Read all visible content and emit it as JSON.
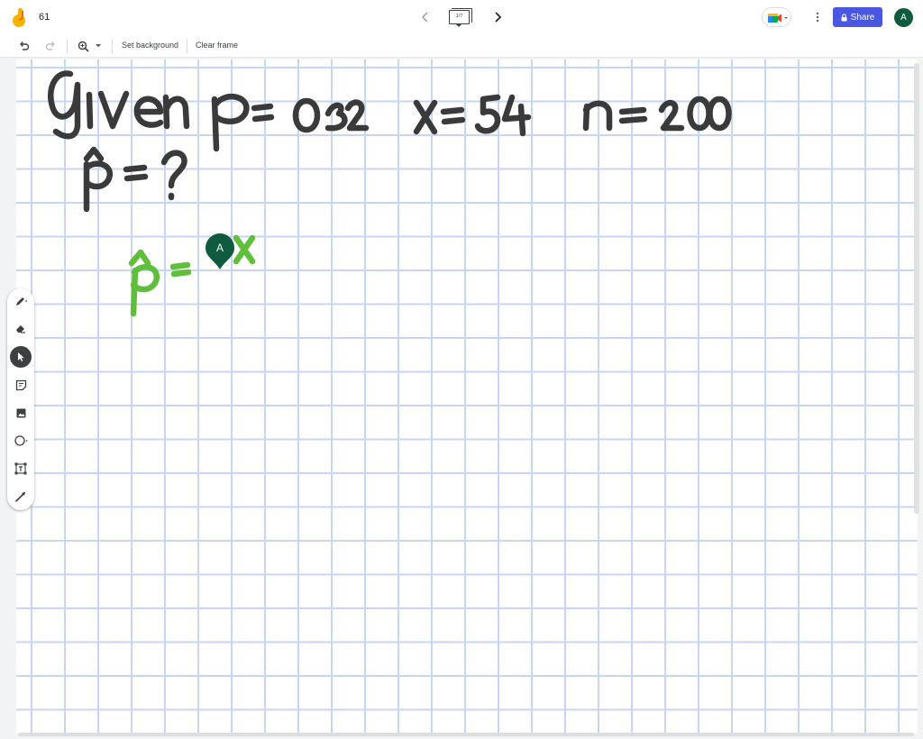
{
  "app": {
    "doc_title": "61",
    "frame_counter": "1/7",
    "share_label": "Share",
    "account_initial": "A"
  },
  "toolbar": {
    "set_background": "Set background",
    "clear_frame": "Clear frame"
  },
  "board": {
    "given_label": "given:",
    "p_value": "p = 0.32",
    "x_value": "x = 54",
    "n_value": "n = 200",
    "question": "p̂ = ?",
    "formula_start": "p̂ = x"
  },
  "collaborator": {
    "initial": "A",
    "color": "#0f5b3e"
  },
  "tools": [
    "pen-icon",
    "eraser-icon",
    "select-icon",
    "sticky-note-icon",
    "image-icon",
    "circle-icon",
    "text-box-icon",
    "laser-icon"
  ],
  "colors": {
    "accent": "#4a57e0",
    "ink_dark": "#3a3a3a",
    "ink_green": "#5fbf3a",
    "grid": "#c8d6f6"
  }
}
